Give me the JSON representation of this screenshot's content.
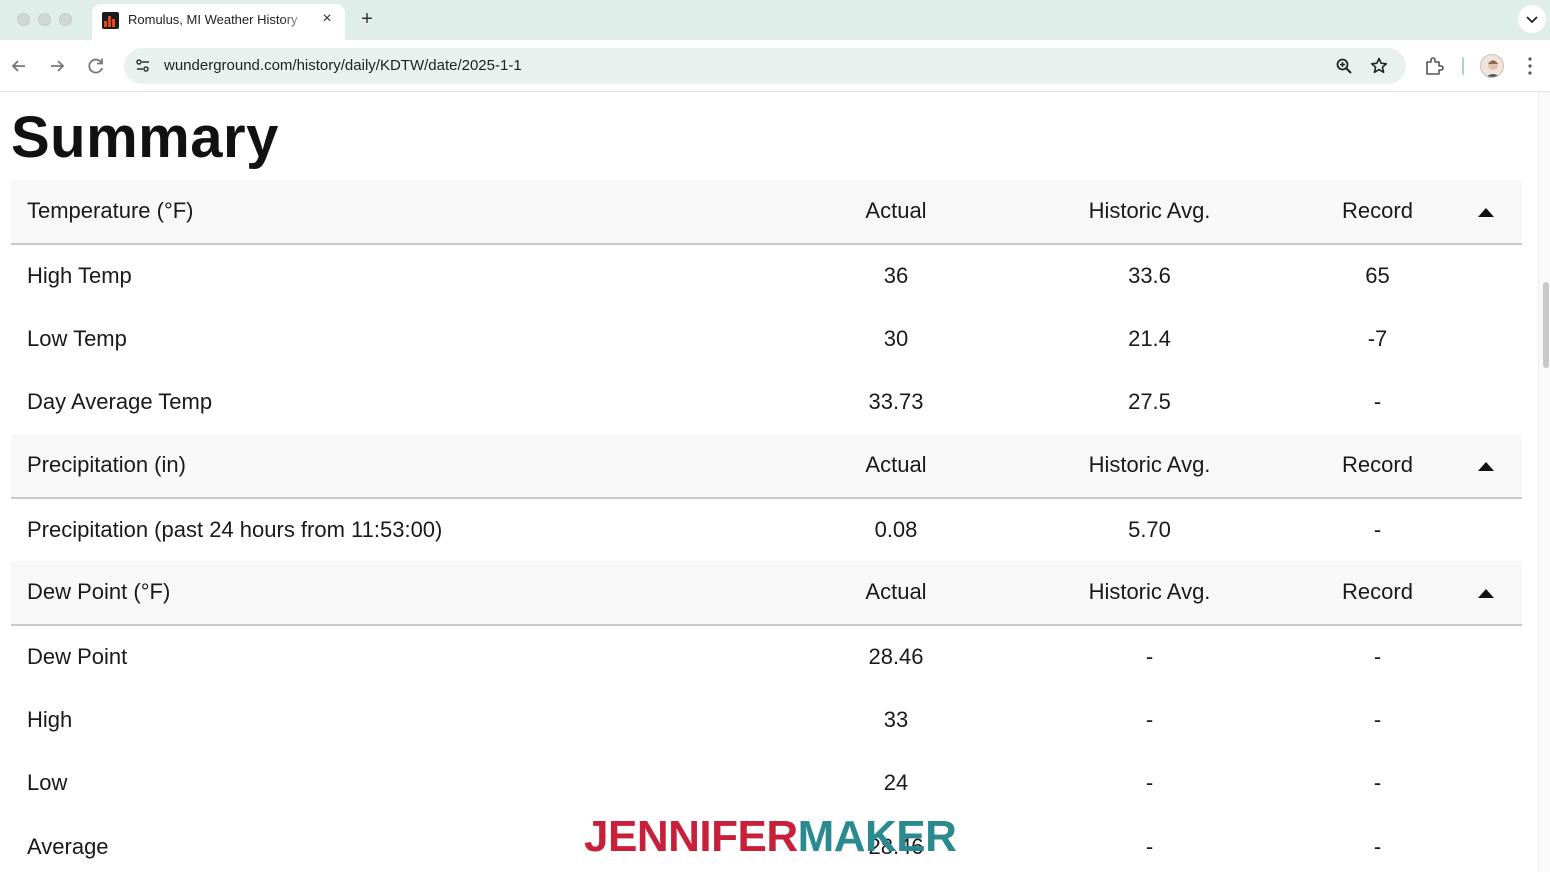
{
  "browser": {
    "tab_title": "Romulus, MI Weather History",
    "url": "wunderground.com/history/daily/KDTW/date/2025-1-1",
    "new_tab_label": "+",
    "close_label": "×"
  },
  "page": {
    "title": "Summary"
  },
  "column_labels": {
    "actual": "Actual",
    "historic": "Historic Avg.",
    "record": "Record"
  },
  "sections": [
    {
      "title": "Temperature (°F)",
      "rows": [
        {
          "label": "High Temp",
          "actual": "36",
          "historic": "33.6",
          "record": "65"
        },
        {
          "label": "Low Temp",
          "actual": "30",
          "historic": "21.4",
          "record": "-7"
        },
        {
          "label": "Day Average Temp",
          "actual": "33.73",
          "historic": "27.5",
          "record": "-"
        }
      ]
    },
    {
      "title": "Precipitation (in)",
      "rows": [
        {
          "label": "Precipitation (past 24 hours from 11:53:00)",
          "actual": "0.08",
          "historic": "5.70",
          "record": "-"
        }
      ]
    },
    {
      "title": "Dew Point (°F)",
      "rows": [
        {
          "label": "Dew Point",
          "actual": "28.46",
          "historic": "-",
          "record": "-"
        },
        {
          "label": "High",
          "actual": "33",
          "historic": "-",
          "record": "-"
        },
        {
          "label": "Low",
          "actual": "24",
          "historic": "-",
          "record": "-"
        },
        {
          "label": "Average",
          "actual": "28.46",
          "historic": "-",
          "record": "-"
        }
      ]
    }
  ],
  "watermark": {
    "part1": "JENNIFER",
    "part2": "MAKER",
    "color1": "#c8203a",
    "color2": "#2b8a8f"
  },
  "colors": {
    "tabstrip": "#dfeee9",
    "omnibox": "#e8f1ee",
    "header_row": "#f8f8f8"
  }
}
